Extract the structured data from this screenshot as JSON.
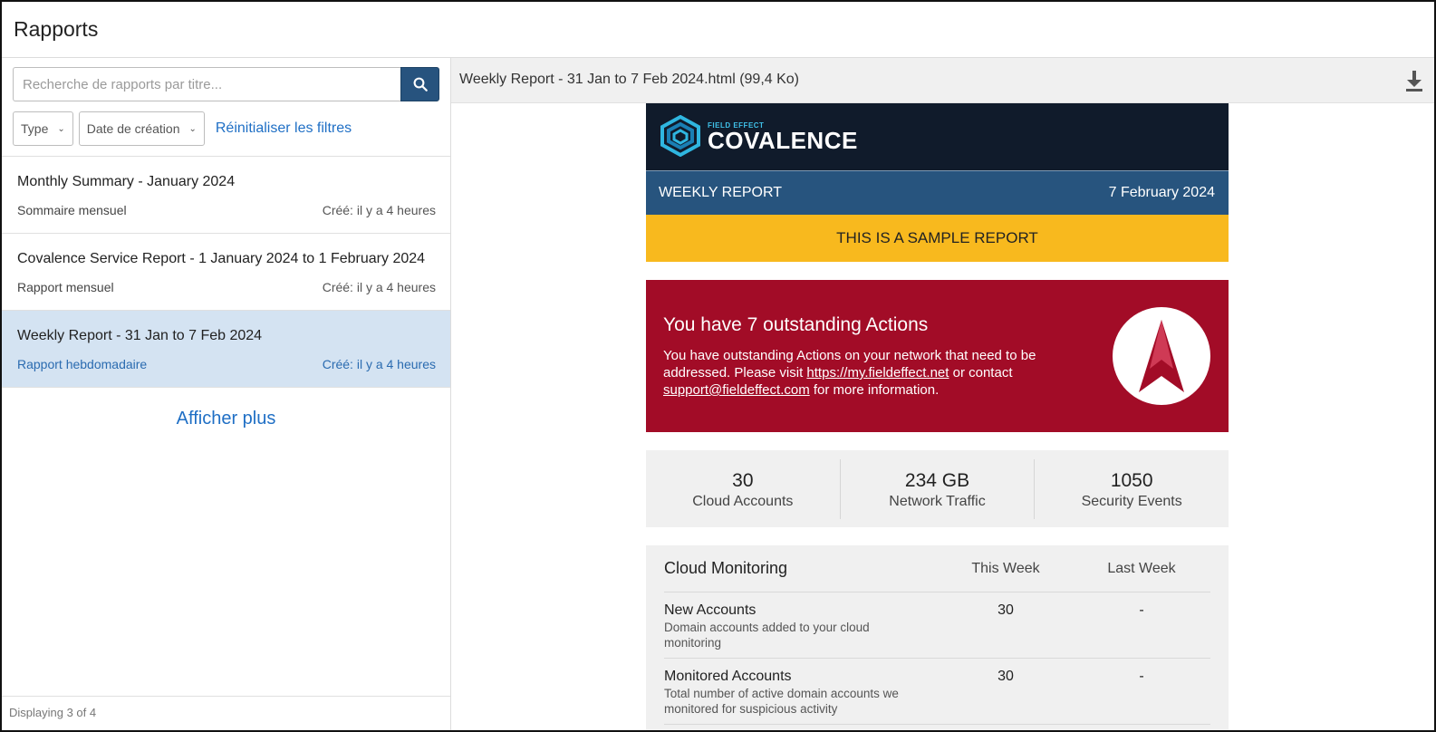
{
  "app": {
    "title": "Rapports"
  },
  "search": {
    "placeholder": "Recherche de rapports par titre..."
  },
  "filters": {
    "type_label": "Type",
    "date_label": "Date de création",
    "reset_label": "Réinitialiser les filtres"
  },
  "reports": [
    {
      "title": "Monthly Summary - January 2024",
      "kind": "Sommaire mensuel",
      "created": "Créé: il y a 4 heures"
    },
    {
      "title": "Covalence Service Report - 1 January 2024 to 1 February 2024",
      "kind": "Rapport mensuel",
      "created": "Créé: il y a 4 heures"
    },
    {
      "title": "Weekly Report - 31 Jan to 7 Feb 2024",
      "kind": "Rapport hebdomadaire",
      "created": "Créé: il y a 4 heures",
      "selected": true
    }
  ],
  "list": {
    "show_more": "Afficher plus",
    "footer": "Displaying 3 of 4"
  },
  "viewer": {
    "filename": "Weekly Report - 31 Jan to 7 Feb 2024.html (99,4 Ko)"
  },
  "report": {
    "logo_small": "FIELD EFFECT",
    "logo_big": "COVALENCE",
    "band_left": "WEEKLY REPORT",
    "band_right": "7 February 2024",
    "sample_notice": "THIS IS A SAMPLE REPORT",
    "alert_title": "You have 7 outstanding Actions",
    "alert_text_1": "You have outstanding Actions on your network that need to be addressed. Please visit ",
    "alert_link_1": "https://my.fieldeffect.net",
    "alert_text_2": " or contact ",
    "alert_link_2": "support@fieldeffect.com",
    "alert_text_3": " for more information.",
    "stats": [
      {
        "value": "30",
        "label": "Cloud Accounts"
      },
      {
        "value": "234 GB",
        "label": "Network Traffic"
      },
      {
        "value": "1050",
        "label": "Security Events"
      }
    ],
    "cloud": {
      "title": "Cloud Monitoring",
      "col_this": "This Week",
      "col_last": "Last Week",
      "rows": [
        {
          "name": "New Accounts",
          "desc": "Domain accounts added to your cloud monitoring",
          "this": "30",
          "last": "-"
        },
        {
          "name": "Monitored Accounts",
          "desc": "Total number of active domain accounts we monitored for suspicious activity",
          "this": "30",
          "last": "-"
        }
      ]
    }
  },
  "colors": {
    "accent_blue": "#27537e",
    "link_blue": "#1f6fc5",
    "selected_row": "#d4e3f2",
    "alert_red": "#a20c27",
    "sample_yellow": "#f8b91e",
    "report_dark": "#101b2b"
  }
}
